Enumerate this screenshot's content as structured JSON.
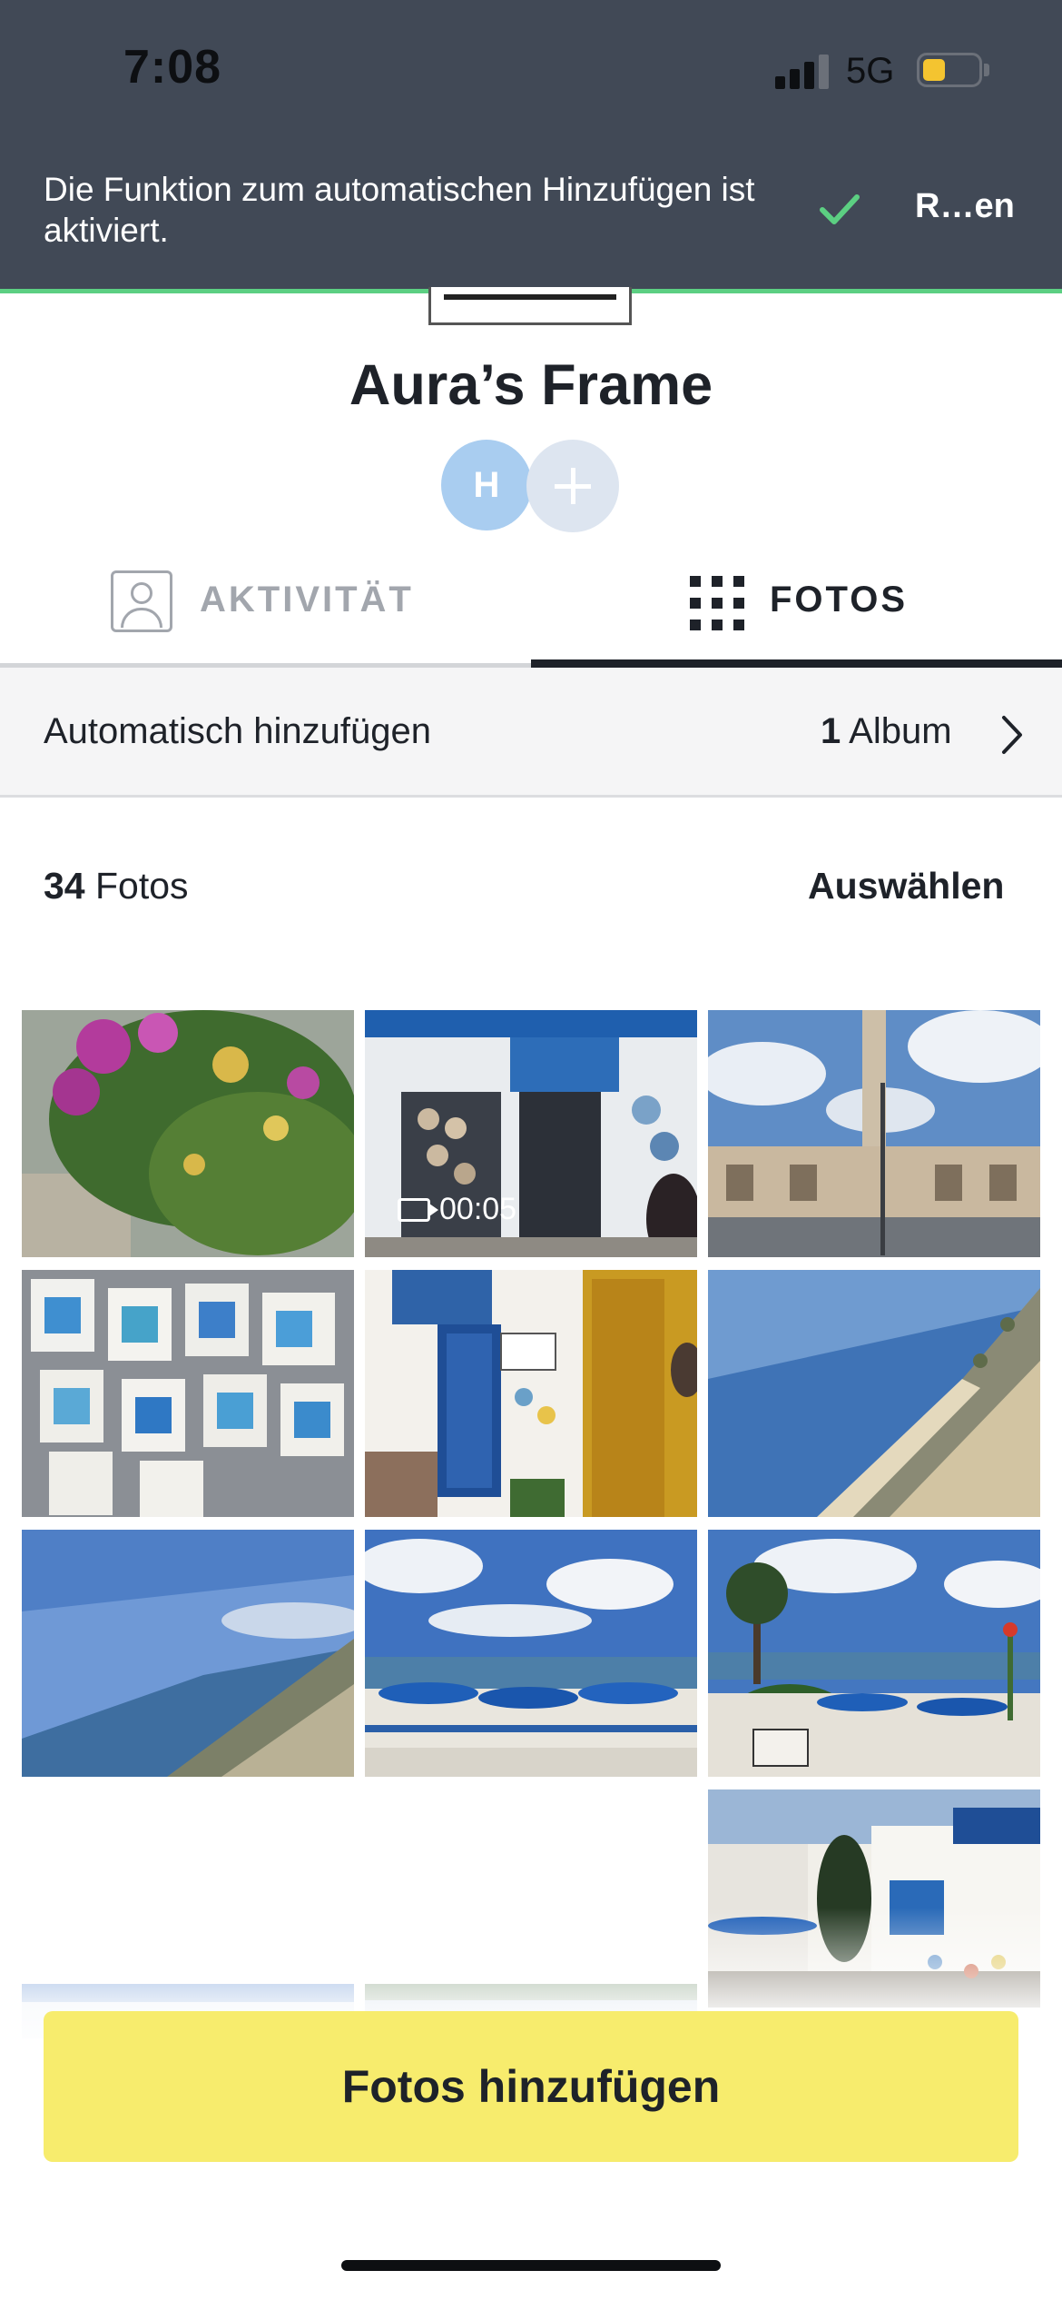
{
  "status_bar": {
    "time": "7:08",
    "network": "5G"
  },
  "banner": {
    "message": "Die Funktion zum automatischen Hinzufügen ist aktiviert.",
    "action_label": "R…en",
    "accent_color": "#5ccf82",
    "background_color": "#414956"
  },
  "frame": {
    "title": "Aura’s Frame",
    "member_initial": "H"
  },
  "tabs": [
    {
      "label": "AKTIVITÄT",
      "icon": "person-icon",
      "selected": false
    },
    {
      "label": "FOTOS",
      "icon": "grid-icon",
      "selected": true
    }
  ],
  "auto_add": {
    "label": "Automatisch hinzufügen",
    "count": "1",
    "unit": "Album"
  },
  "photos_header": {
    "count": "34",
    "unit": "Fotos",
    "select_label": "Auswählen"
  },
  "photos": [
    {
      "subject": "bougainvillea-bush"
    },
    {
      "subject": "ceramics-shop",
      "video_duration": "00:05"
    },
    {
      "subject": "mosque-minaret"
    },
    {
      "subject": "paintings-wall"
    },
    {
      "subject": "blue-door-house"
    },
    {
      "subject": "aerial-coast"
    },
    {
      "subject": "aerial-sky-coast"
    },
    {
      "subject": "cafe-terrace-sea"
    },
    {
      "subject": "palm-terrace-cafe"
    },
    {
      "subject": "street-market"
    }
  ],
  "cta": {
    "label": "Fotos hinzufügen",
    "color": "#f7ec6d"
  }
}
